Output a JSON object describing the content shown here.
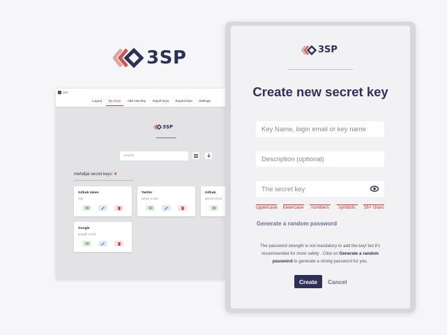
{
  "brand": {
    "name": "3SP",
    "primary_color": "#2f3057",
    "accent_color": "#b03535"
  },
  "app_window": {
    "brand_small": "3SP",
    "nav": [
      {
        "label": "Logout"
      },
      {
        "label": "My Keys",
        "active": true
      },
      {
        "label": "Add new key"
      },
      {
        "label": "Import keys"
      },
      {
        "label": "Export keys"
      },
      {
        "label": "Settings"
      }
    ],
    "logo_text": "3SP",
    "search": {
      "placeholder": "Search"
    },
    "keys_title": "mehdijai secret keys:",
    "keys_count": "4",
    "cards": [
      {
        "title": "Github token",
        "subtitle": "3sp"
      },
      {
        "title": "Twitter",
        "subtitle": "twitter email"
      },
      {
        "title": "Github",
        "subtitle": "github email"
      },
      {
        "title": "Google",
        "subtitle": "google email"
      }
    ]
  },
  "form": {
    "logo_text": "3SP",
    "title": "Create new secret key",
    "name_placeholder": "Key Name, login email or key name",
    "description_placeholder": "Description (optional)",
    "secret_placeholder": "The secret key",
    "strength": [
      "uppercase",
      "lowercase",
      "numbers",
      "symbols",
      "16+ chars"
    ],
    "generate_link": "Generate a random password",
    "note_part1": "The password strength is not mandatory to add the key! but it's recommended for more safety . Click on ",
    "note_bold": "Generate a random password",
    "note_part2": " to generate a strong password for you.",
    "create_label": "Create",
    "cancel_label": "Cancel"
  }
}
